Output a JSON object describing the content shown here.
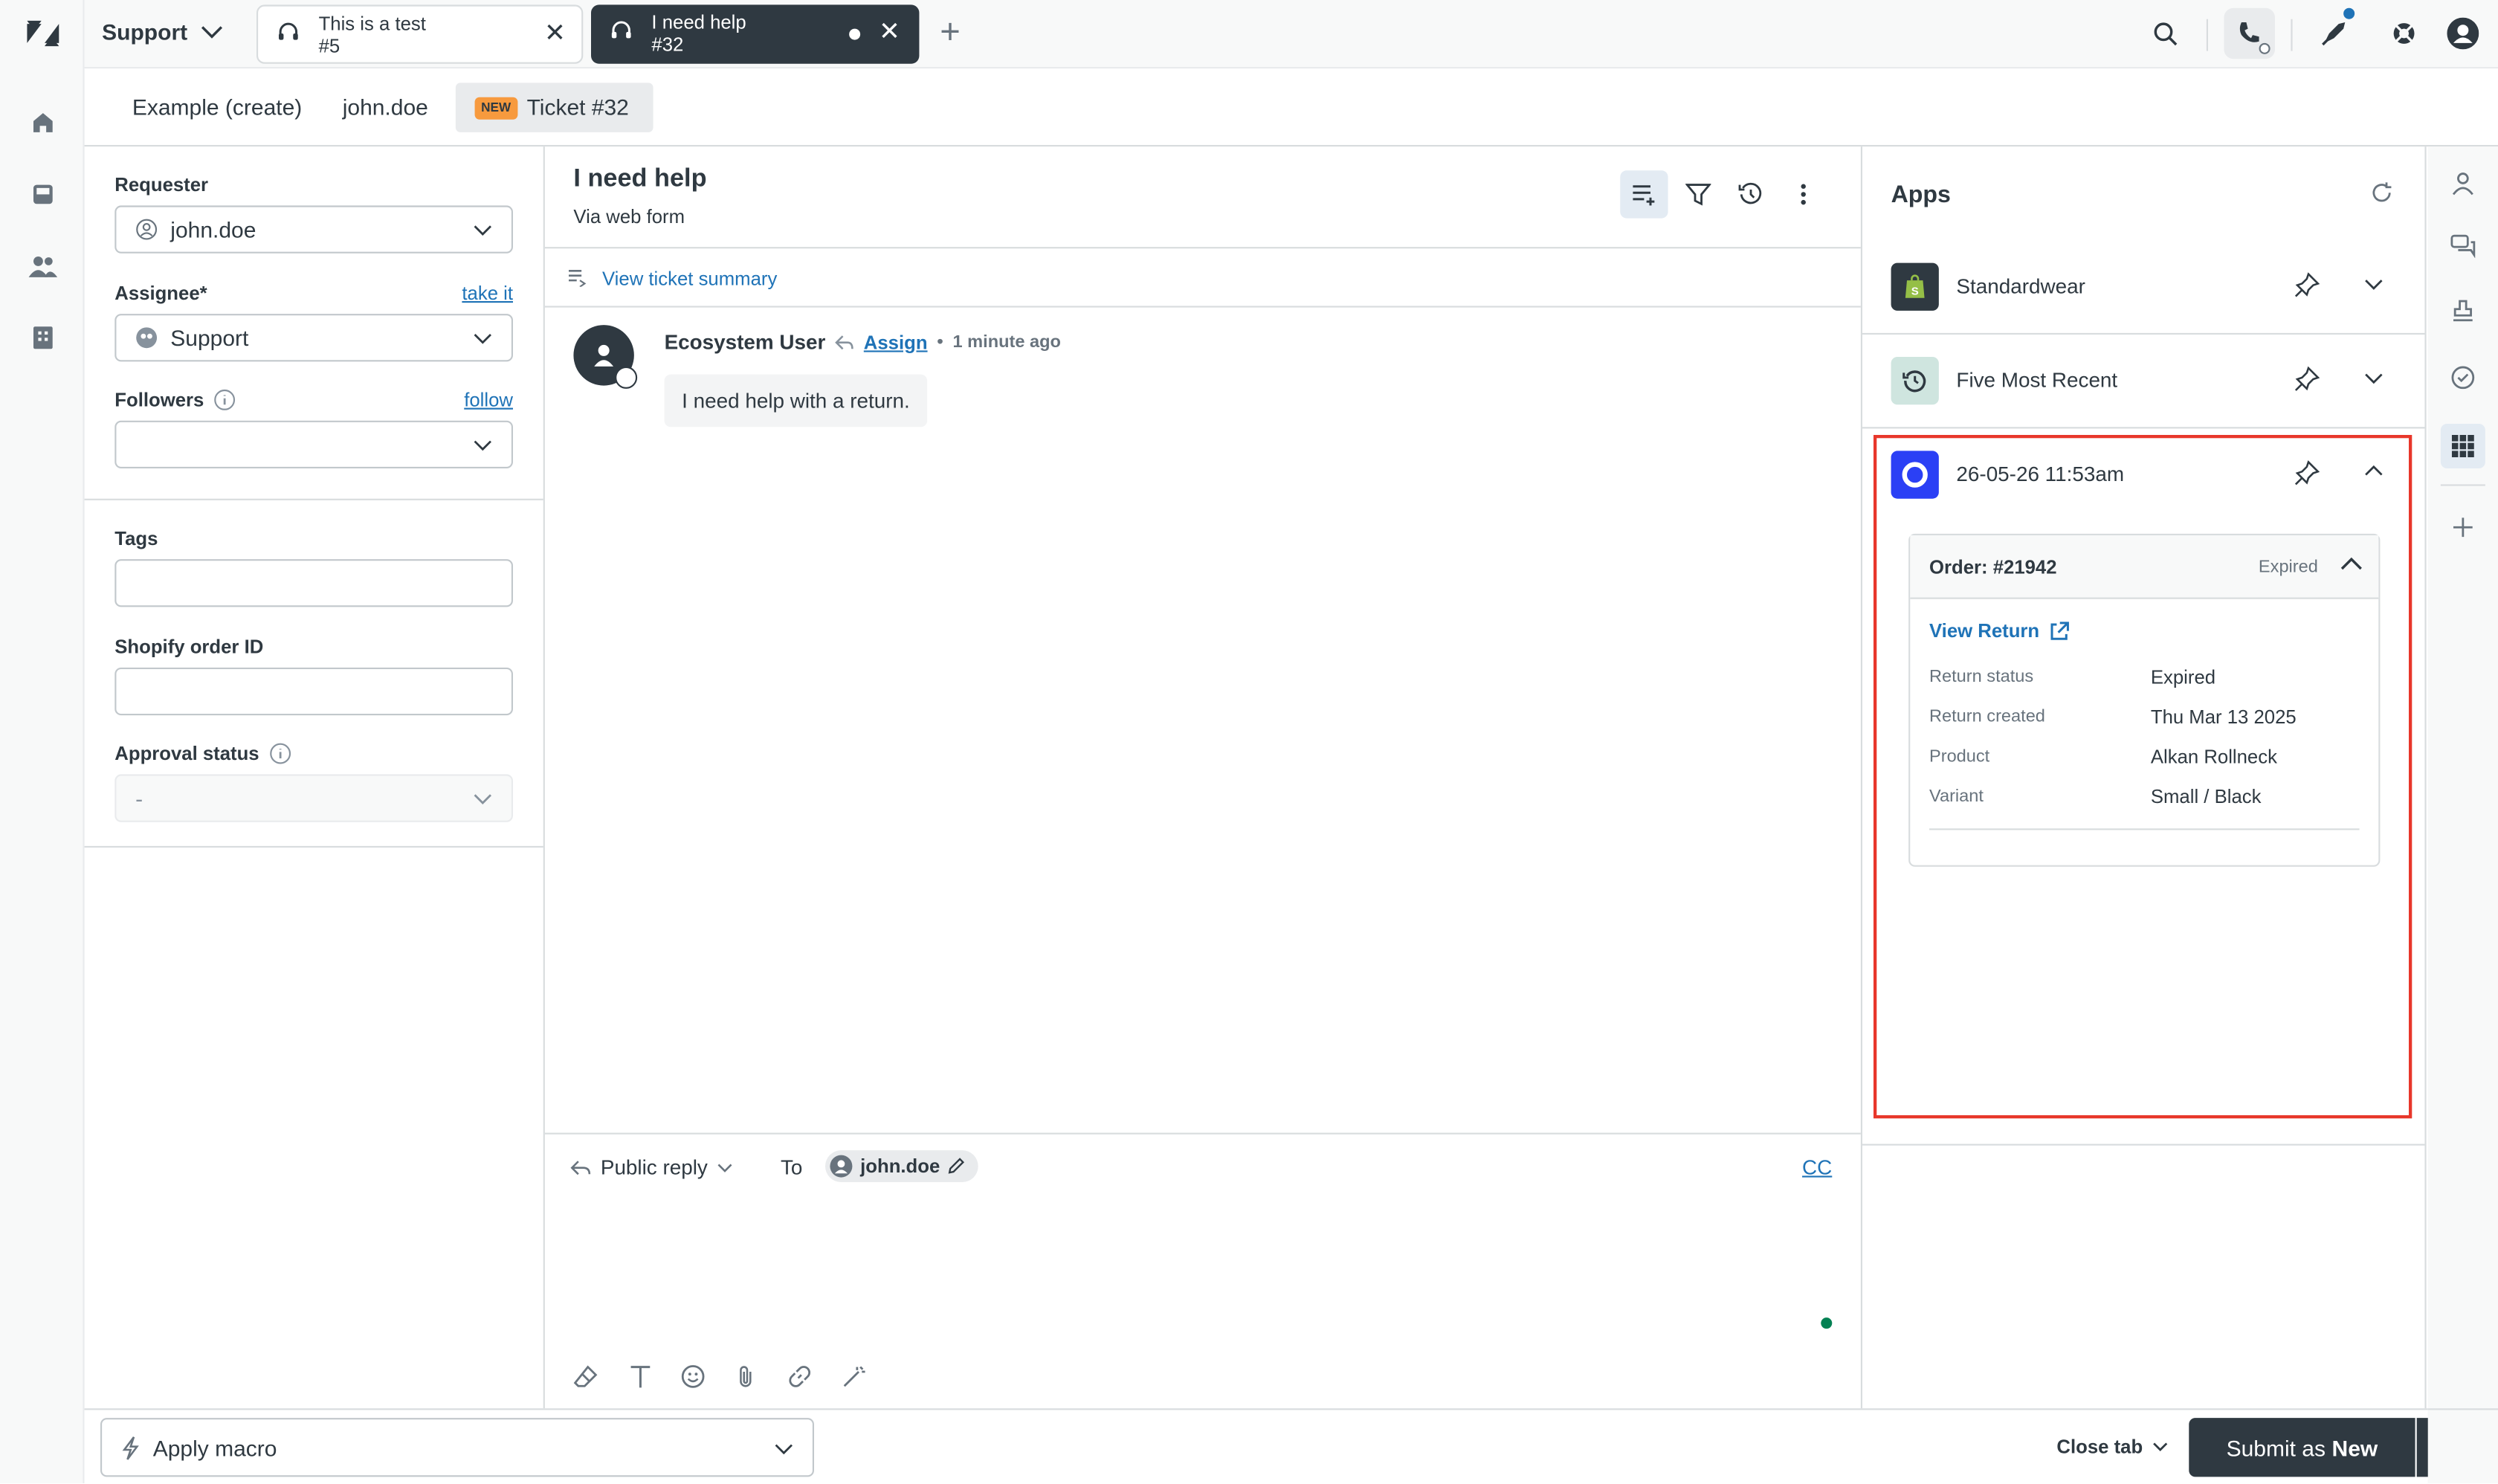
{
  "colors": {
    "accent": "#1f73b7",
    "dark": "#2f3941",
    "highlight": "#e8372b",
    "new_badge": "#f79a3e",
    "online": "#038153"
  },
  "topbar": {
    "product": "Support",
    "tabs": [
      {
        "title": "This is a test",
        "subtitle": "#5"
      },
      {
        "title": "I need help",
        "subtitle": "#32"
      }
    ]
  },
  "subtabs": {
    "items": [
      "Example (create)",
      "john.doe"
    ],
    "active_badge": "NEW",
    "active_label": "Ticket #32"
  },
  "properties": {
    "requester_label": "Requester",
    "requester_value": "john.doe",
    "assignee_label": "Assignee*",
    "assignee_link": "take it",
    "assignee_value": "Support",
    "followers_label": "Followers",
    "followers_link": "follow",
    "tags_label": "Tags",
    "shopify_label": "Shopify order ID",
    "approval_label": "Approval status",
    "approval_value": "-"
  },
  "conversation": {
    "title": "I need help",
    "via": "Via web form",
    "summary_link": "View ticket summary",
    "author": "Ecosystem User",
    "assign_link": "Assign",
    "time": "1 minute ago",
    "message": "I need help with a return."
  },
  "composer": {
    "mode": "Public reply",
    "to_label": "To",
    "recipient": "john.doe",
    "cc": "CC"
  },
  "apps": {
    "title": "Apps",
    "items": [
      {
        "name": "Standardwear"
      },
      {
        "name": "Five Most Recent"
      },
      {
        "name": "26-05-26 11:53am"
      }
    ],
    "order": {
      "title": "Order: #21942",
      "status": "Expired",
      "view_link": "View Return",
      "rows": [
        {
          "key": "Return status",
          "value": "Expired"
        },
        {
          "key": "Return created",
          "value": "Thu Mar 13 2025"
        },
        {
          "key": "Product",
          "value": "Alkan Rollneck"
        },
        {
          "key": "Variant",
          "value": "Small / Black"
        }
      ]
    }
  },
  "footer": {
    "macro": "Apply macro",
    "close_tab": "Close tab",
    "submit_prefix": "Submit as",
    "submit_status": "New"
  }
}
